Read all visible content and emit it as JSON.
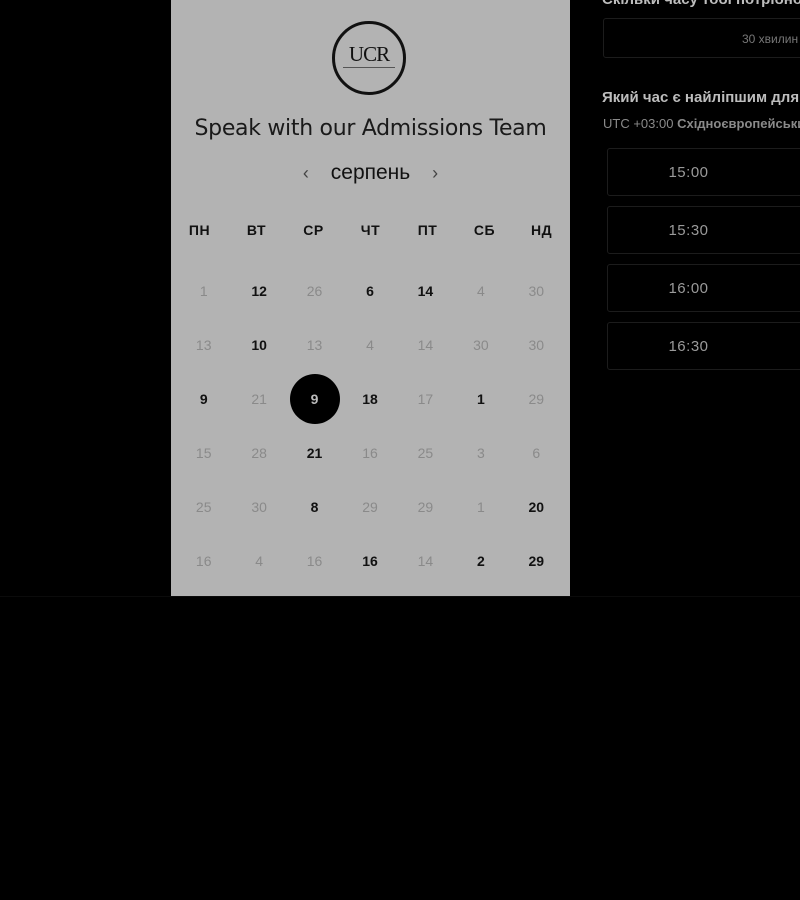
{
  "logo": {
    "text": "UCR"
  },
  "calendar": {
    "title": "Speak with our Admissions Team",
    "month": "серпень",
    "prev_icon": "chevron-left-icon",
    "next_icon": "chevron-right-icon",
    "weekdays": [
      "ПН",
      "ВТ",
      "СР",
      "ЧТ",
      "ПТ",
      "СБ",
      "НД"
    ],
    "weeks": [
      [
        {
          "d": "1",
          "a": false
        },
        {
          "d": "12",
          "a": true
        },
        {
          "d": "26",
          "a": false
        },
        {
          "d": "6",
          "a": true
        },
        {
          "d": "14",
          "a": true
        },
        {
          "d": "4",
          "a": false
        },
        {
          "d": "30",
          "a": false
        }
      ],
      [
        {
          "d": "13",
          "a": false
        },
        {
          "d": "10",
          "a": true
        },
        {
          "d": "13",
          "a": false
        },
        {
          "d": "4",
          "a": false
        },
        {
          "d": "14",
          "a": false
        },
        {
          "d": "30",
          "a": false
        },
        {
          "d": "30",
          "a": false
        }
      ],
      [
        {
          "d": "9",
          "a": true
        },
        {
          "d": "21",
          "a": false
        },
        {
          "d": "9",
          "a": true,
          "selected": true
        },
        {
          "d": "18",
          "a": true
        },
        {
          "d": "17",
          "a": false
        },
        {
          "d": "1",
          "a": true
        },
        {
          "d": "29",
          "a": false
        }
      ],
      [
        {
          "d": "15",
          "a": false
        },
        {
          "d": "28",
          "a": false
        },
        {
          "d": "21",
          "a": true
        },
        {
          "d": "16",
          "a": false
        },
        {
          "d": "25",
          "a": false
        },
        {
          "d": "3",
          "a": false
        },
        {
          "d": "6",
          "a": false
        }
      ],
      [
        {
          "d": "25",
          "a": false
        },
        {
          "d": "30",
          "a": false
        },
        {
          "d": "8",
          "a": true
        },
        {
          "d": "29",
          "a": false
        },
        {
          "d": "29",
          "a": false
        },
        {
          "d": "1",
          "a": false
        },
        {
          "d": "20",
          "a": true
        }
      ],
      [
        {
          "d": "16",
          "a": false
        },
        {
          "d": "4",
          "a": false
        },
        {
          "d": "16",
          "a": false
        },
        {
          "d": "16",
          "a": true
        },
        {
          "d": "14",
          "a": false
        },
        {
          "d": "2",
          "a": true
        },
        {
          "d": "29",
          "a": true
        }
      ]
    ]
  },
  "panel": {
    "duration_question": "Скільки часу тобі потрібно?",
    "duration_value": "30 хвилин",
    "time_question": "Який час є найліпшим для тебе?",
    "timezone_offset": "UTC +03:00",
    "timezone_name": "Східноєвропейський час",
    "slots": [
      "15:00",
      "15:30",
      "16:00",
      "16:30"
    ]
  }
}
